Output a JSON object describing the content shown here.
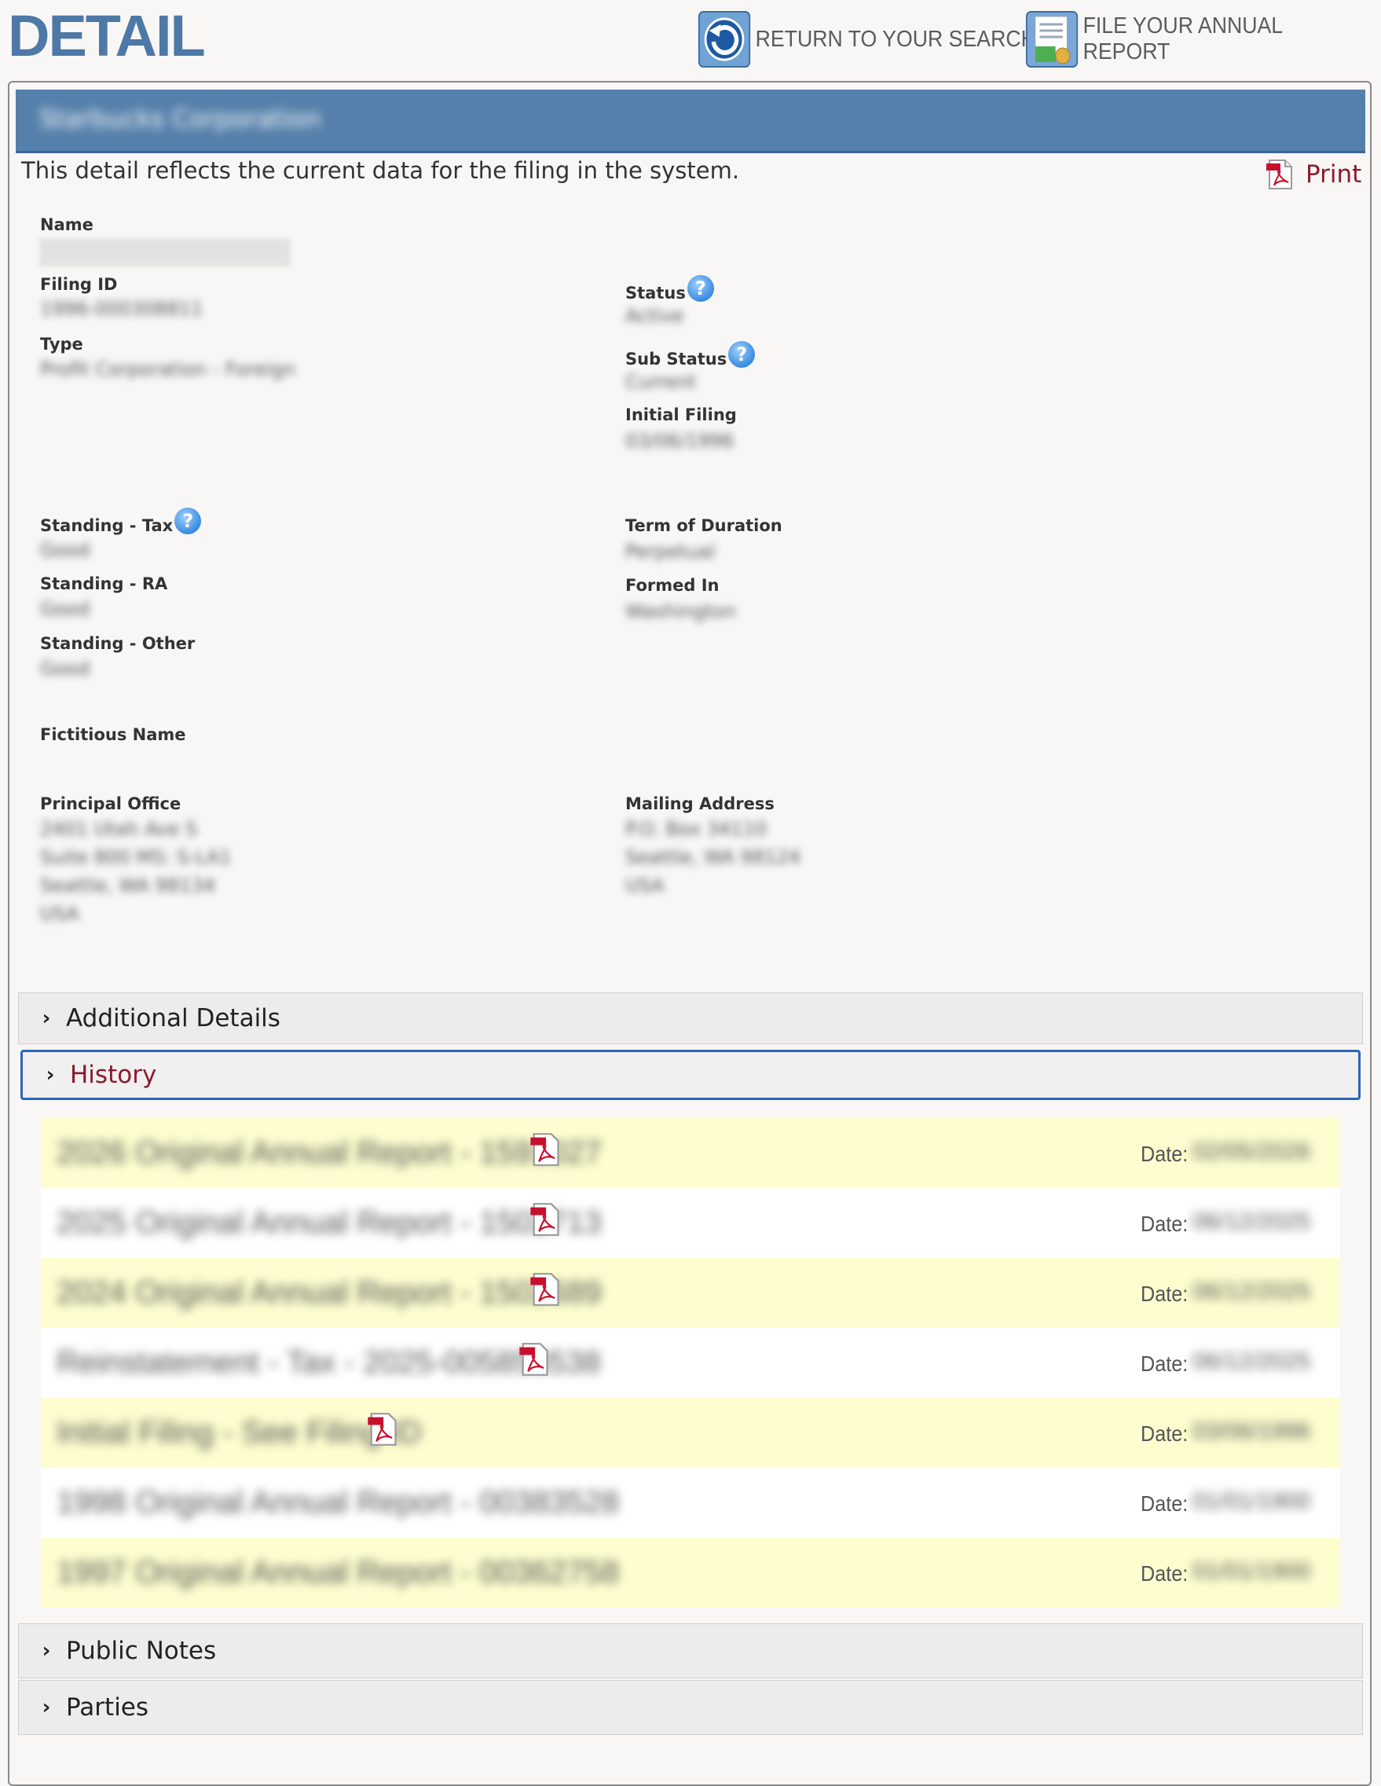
{
  "header": {
    "title": "DETAIL",
    "return_label": "RETURN TO YOUR SEARCH",
    "annual_label": "FILE YOUR ANNUAL REPORT"
  },
  "entity": {
    "name": "Starbucks Corporation"
  },
  "intro": "This detail reflects the current data for the filing in the system.",
  "print_label": "Print",
  "fields": {
    "name_label": "Name",
    "filing_id_label": "Filing ID",
    "filing_id": "1996-000308811",
    "type_label": "Type",
    "type": "Profit Corporation - Foreign",
    "status_label": "Status",
    "status": "Active",
    "sub_status_label": "Sub Status",
    "sub_status": "Current",
    "initial_filing_label": "Initial Filing",
    "initial_filing": "03/06/1996",
    "standing_tax_label": "Standing - Tax",
    "standing_tax": "Good",
    "standing_ra_label": "Standing - RA",
    "standing_ra": "Good",
    "standing_other_label": "Standing - Other",
    "standing_other": "Good",
    "term_label": "Term of Duration",
    "term": "Perpetual",
    "formed_in_label": "Formed In",
    "formed_in": "Washington",
    "fictitious_label": "Fictitious Name",
    "principal_label": "Principal Office",
    "principal": [
      "2401 Utah Ave S",
      "Suite 800 MS: S-LA1",
      "Seattle, WA 98134",
      "USA"
    ],
    "mailing_label": "Mailing Address",
    "mailing": [
      "P.O. Box 34110",
      "Seattle, WA 98124",
      "USA"
    ]
  },
  "sections": {
    "additional": "Additional Details",
    "history": "History",
    "public_notes": "Public Notes",
    "parties": "Parties"
  },
  "history": {
    "date_label": "Date:",
    "rows": [
      {
        "desc": "2026 Original Annual Report - 1591027",
        "date": "02/05/2026"
      },
      {
        "desc": "2025 Original Annual Report - 1502713",
        "date": "06/12/2025"
      },
      {
        "desc": "2024 Original Annual Report - 1502689",
        "date": "06/12/2025"
      },
      {
        "desc": "Reinstatement - Tax - 2025-005858538",
        "date": "06/12/2025"
      },
      {
        "desc": "Initial Filing - See Filing ID",
        "date": "03/06/1996"
      },
      {
        "desc": "1998 Original Annual Report - 00383528",
        "date": "01/01/1900"
      },
      {
        "desc": "1997 Original Annual Report - 00362758",
        "date": "01/01/1900"
      }
    ]
  },
  "colors": {
    "title_blue": "#4e78a6",
    "entity_bar": "#5580ab",
    "link_maroon": "#8a1a2e",
    "row_highlight": "#fdfdcf",
    "focus_border": "#2d64b8"
  },
  "icons": {
    "return": "return-arrow-icon",
    "annual": "annual-report-icon",
    "print": "pdf-icon",
    "help": "help-icon",
    "chevron": "chevron-right-icon"
  }
}
